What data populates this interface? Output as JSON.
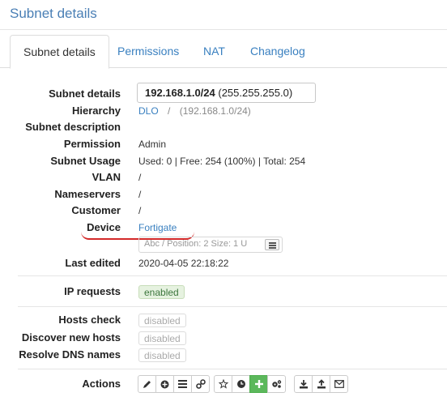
{
  "page": {
    "title": "Subnet details"
  },
  "tabs": [
    {
      "label": "Subnet details",
      "active": true
    },
    {
      "label": "Permissions"
    },
    {
      "label": "NAT"
    },
    {
      "label": "Changelog"
    }
  ],
  "details": {
    "subnet_label": "Subnet details",
    "subnet_value": "192.168.1.0/24",
    "subnet_mask": "(255.255.255.0)",
    "hierarchy_label": "Hierarchy",
    "hierarchy_root": "DLO",
    "hierarchy_sep": "/",
    "hierarchy_current": "(192.168.1.0/24)",
    "description_label": "Subnet description",
    "permission_label": "Permission",
    "permission_value": "Admin",
    "usage_label": "Subnet Usage",
    "usage_value": "Used: 0 | Free: 254 (100%) | Total: 254",
    "vlan_label": "VLAN",
    "vlan_value": "/",
    "nameservers_label": "Nameservers",
    "nameservers_value": "/",
    "customer_label": "Customer",
    "customer_value": "/",
    "device_label": "Device",
    "device_value": "Fortigate",
    "device_detail": "Abc / Position: 2 Size: 1 U",
    "last_edited_label": "Last edited",
    "last_edited_value": "2020-04-05 22:18:22"
  },
  "requests": {
    "label": "IP requests",
    "status": "enabled"
  },
  "discovery": {
    "hosts_check_label": "Hosts check",
    "hosts_check_status": "disabled",
    "discover_label": "Discover new hosts",
    "discover_status": "disabled",
    "resolve_label": "Resolve DNS names",
    "resolve_status": "disabled"
  },
  "actions": {
    "label": "Actions",
    "icons": [
      "pencil-icon",
      "plus-circle-icon",
      "list-icon",
      "link-icon",
      "star-icon",
      "clock-icon",
      "plus-icon",
      "cogs-icon",
      "download-icon",
      "upload-icon",
      "envelope-icon"
    ],
    "accent_color": "#5cb85c"
  },
  "colors": {
    "link": "#3a80c0",
    "annotation": "#d42a2a"
  }
}
